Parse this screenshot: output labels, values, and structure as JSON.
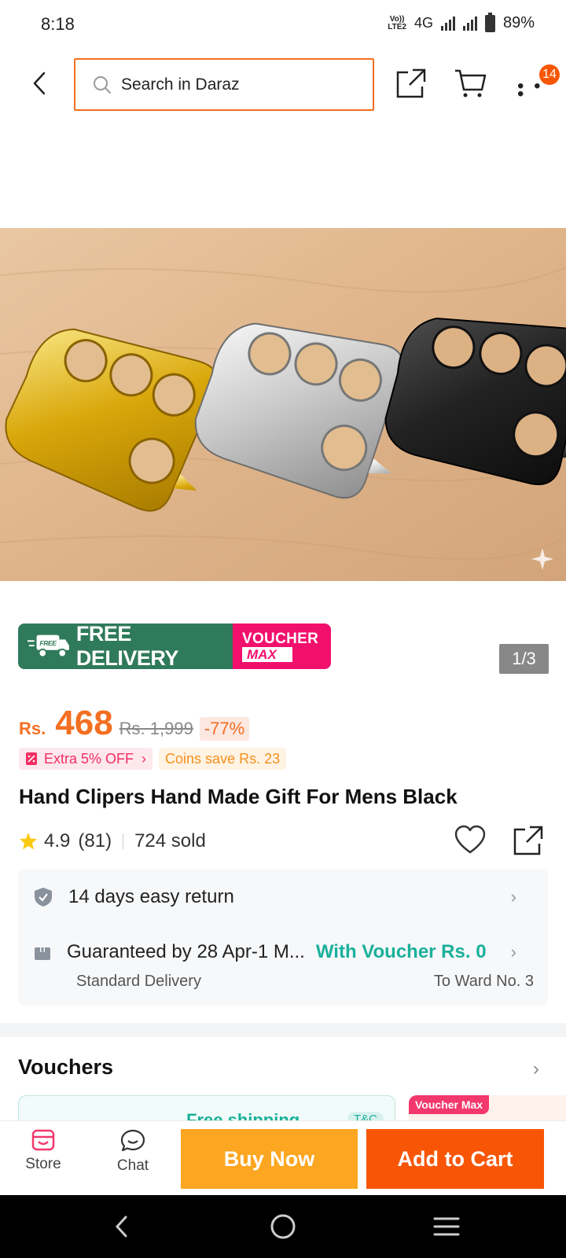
{
  "status_bar": {
    "time": "8:18",
    "volte_top": "Vo))",
    "volte_bottom": "LTE2",
    "network": "4G",
    "battery": "89%"
  },
  "header": {
    "search_placeholder": "Search in Daraz",
    "cart_badge": "14",
    "icons": [
      "back-arrow-icon",
      "search-icon",
      "share-icon",
      "cart-icon",
      "more-icon"
    ]
  },
  "gallery": {
    "counter": "1/3"
  },
  "promo": {
    "free_label": "FREE",
    "free_delivery": "FREE DELIVERY",
    "voucher_line1": "VOUCHER",
    "voucher_line2": "MAX"
  },
  "price": {
    "currency": "Rs.",
    "value": "468",
    "original": "Rs. 1,999",
    "discount": "-77%"
  },
  "tags": {
    "extra": "Extra 5% OFF",
    "coins": "Coins save Rs. 23"
  },
  "product": {
    "title": "Hand Clipers Hand Made Gift For Mens Black",
    "rating": "4.9",
    "reviews": "(81)",
    "sold": "724 sold"
  },
  "services": {
    "return": "14 days easy return",
    "guarantee": "Guaranteed by 28 Apr-1 M...",
    "voucher": "With Voucher Rs. 0",
    "delivery_type": "Standard Delivery",
    "destination": "To Ward No. 3"
  },
  "vouchers": {
    "title": "Vouchers",
    "card1_text": "Free shipping",
    "card1_tc": "T&C",
    "card2_badge": "Voucher Max"
  },
  "actions": {
    "store": "Store",
    "chat": "Chat",
    "buy_now": "Buy Now",
    "add_to_cart": "Add to Cart"
  },
  "colors": {
    "accent": "#f85606",
    "price": "#f36f21",
    "buy_now": "#fda621",
    "free_delivery": "#2f7a5a",
    "voucher_max": "#f2106d",
    "voucher_green": "#1ab09b"
  }
}
